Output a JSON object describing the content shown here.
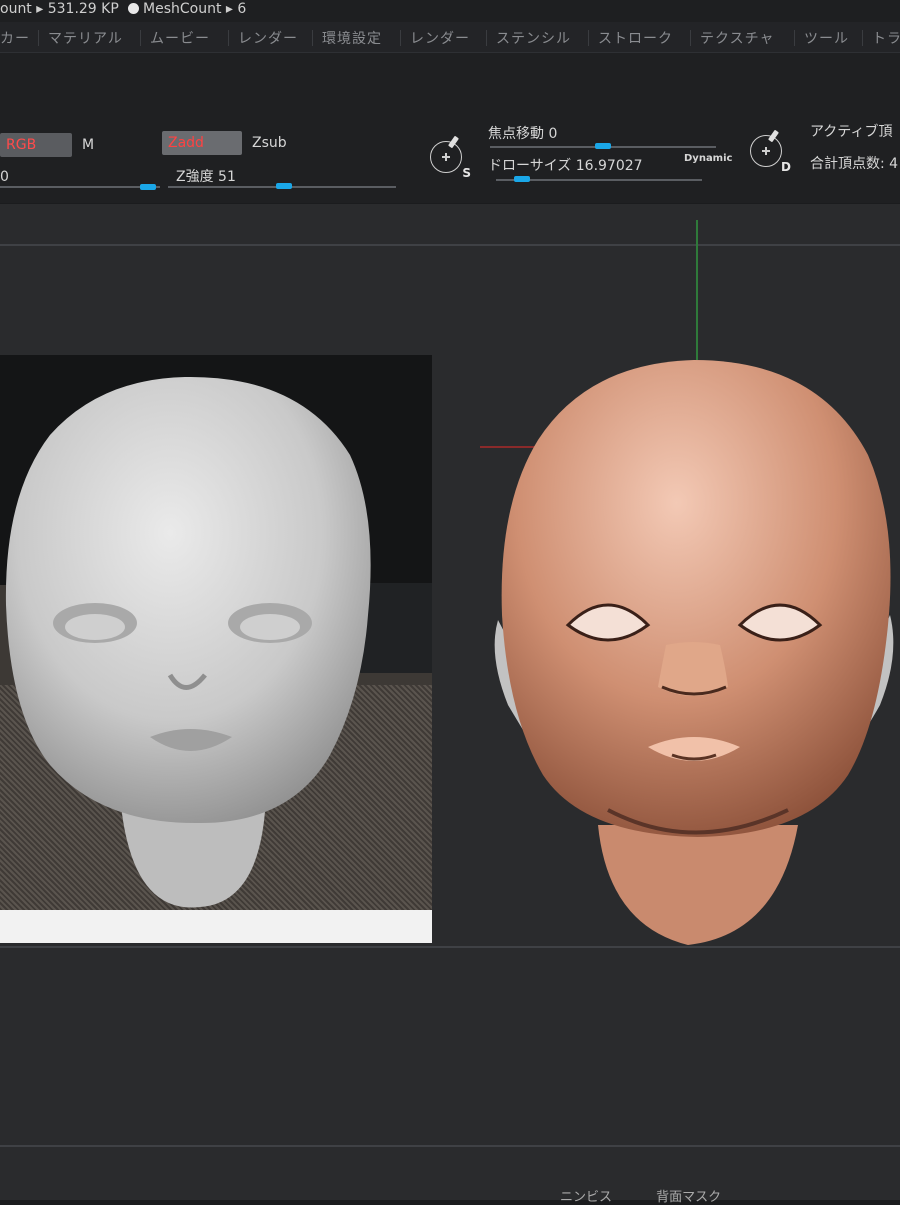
{
  "status_bar": {
    "active_points": "ount ▸ 531.29 KP",
    "mesh_count": "MeshCount ▸ 6"
  },
  "menu": {
    "items": [
      "カー",
      "マテリアル",
      "ムービー",
      "レンダー",
      "環境設定",
      "レンダー",
      "ステンシル",
      "ストローク",
      "テクスチャ",
      "ツール",
      "トラ"
    ]
  },
  "toolbar": {
    "rgb_label": "RGB",
    "m_label": "M",
    "zadd_label": "Zadd",
    "zsub_label": "Zsub",
    "rgb_intensity_value": "0",
    "z_intensity_label": "Z強度 51",
    "focal_shift_label": "焦点移動 0",
    "draw_size_label": "ドローサイズ 16.97027",
    "dynamic_label": "Dynamic",
    "brush_s_letter": "S",
    "brush_d_letter": "D",
    "active_points_label": "アクティブ頂",
    "total_points_label": "合計頂点数: 4",
    "z_intensity_level": 0.51,
    "focal_shift_level": 0.5
  },
  "bottom": {
    "label_left": "ニンビス",
    "label_right": "背面マスク"
  },
  "colors": {
    "accent_blue": "#1aa7e8",
    "zadd_red": "#ff3b3b",
    "clay": "#c8876a"
  }
}
